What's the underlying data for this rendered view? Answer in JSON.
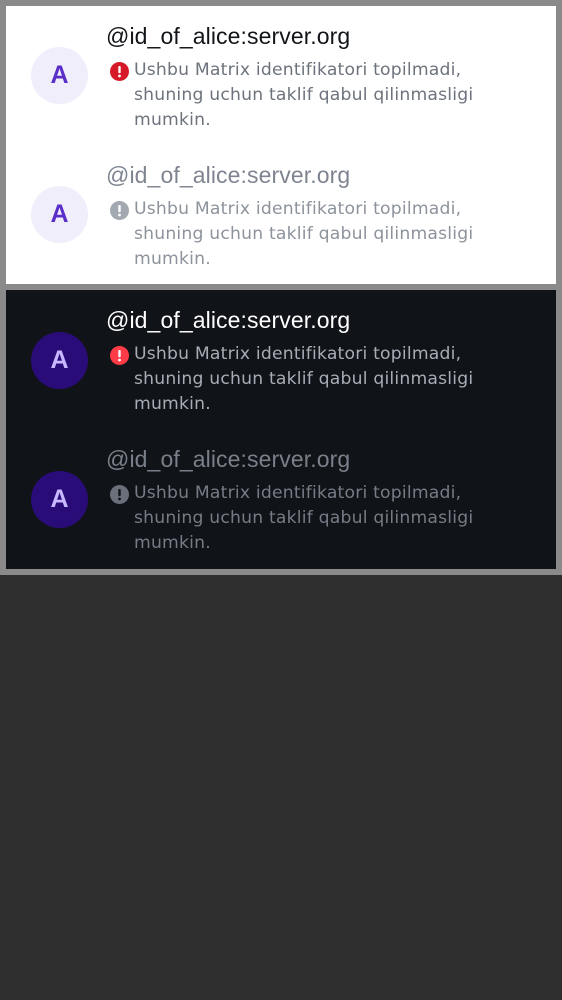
{
  "light_theme": {
    "rows": [
      {
        "state": "active",
        "avatar_initial": "A",
        "user_id": "@id_of_alice:server.org",
        "warning_icon": "error-icon",
        "message": "Ushbu Matrix identifikatori topilmadi, shuning uchun taklif qabul qilinmasligi mumkin."
      },
      {
        "state": "disabled",
        "avatar_initial": "A",
        "user_id": "@id_of_alice:server.org",
        "warning_icon": "error-icon",
        "message": "Ushbu Matrix identifikatori topilmadi, shuning uchun taklif qabul qilinmasligi mumkin."
      }
    ]
  },
  "dark_theme": {
    "rows": [
      {
        "state": "active",
        "avatar_initial": "A",
        "user_id": "@id_of_alice:server.org",
        "warning_icon": "error-icon",
        "message": "Ushbu Matrix identifikatori topilmadi, shuning uchun taklif qabul qilinmasligi mumkin."
      },
      {
        "state": "disabled",
        "avatar_initial": "A",
        "user_id": "@id_of_alice:server.org",
        "warning_icon": "error-icon",
        "message": "Ushbu Matrix identifikatori topilmadi, shuning uchun taklif qabul qilinmasligi mumkin."
      }
    ]
  },
  "colors": {
    "light_background": "#ffffff",
    "dark_background": "#101318",
    "error_light": "#d51928",
    "error_dark": "#ff3b47",
    "avatar_light_bg": "#f1eefc",
    "avatar_dark_bg": "#2a0c78",
    "canvas_background": "#2f2f2f"
  }
}
